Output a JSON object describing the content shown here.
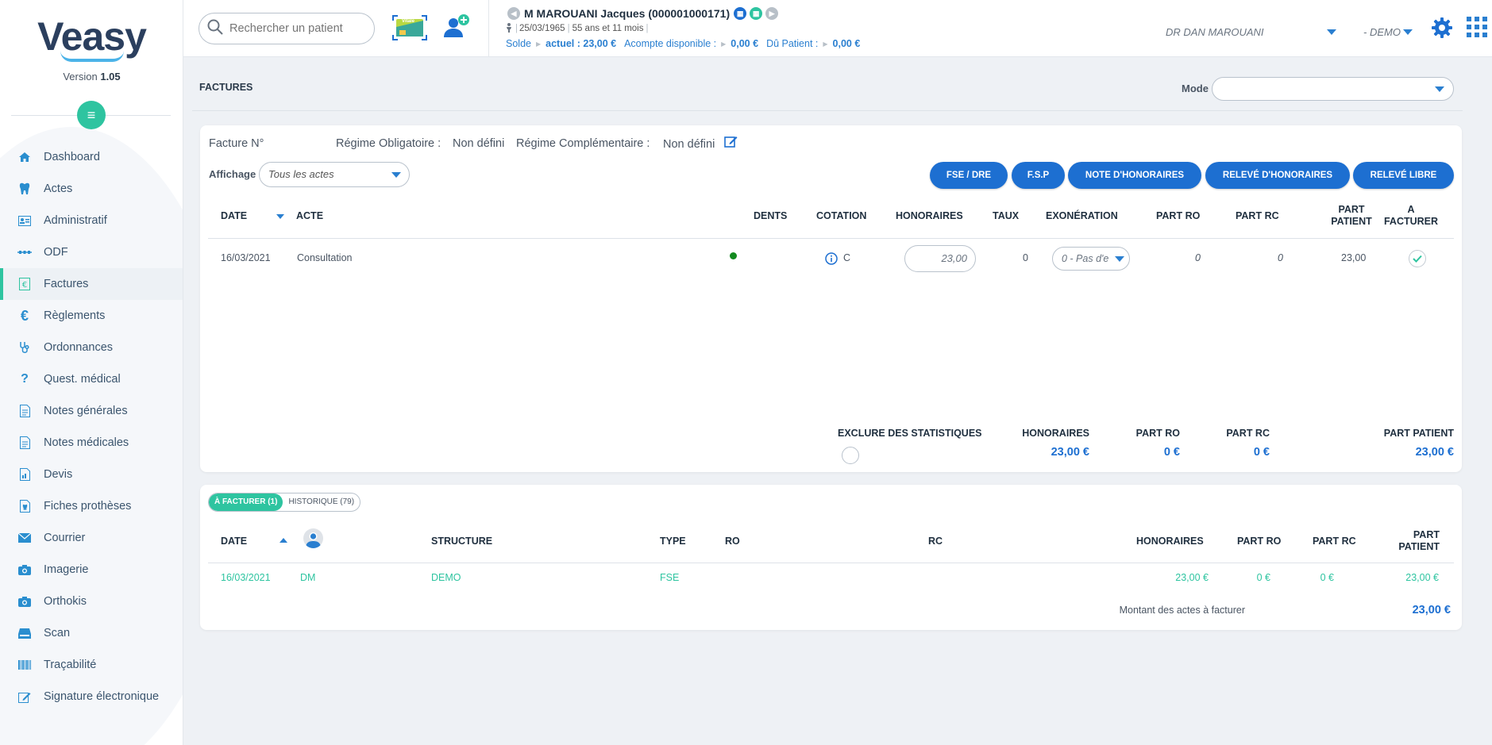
{
  "app": {
    "logo_text": "Veasy",
    "version_label": "Version",
    "version_number": "1.05"
  },
  "sidebar": {
    "items": [
      {
        "label": "Dashboard",
        "icon": "home-icon"
      },
      {
        "label": "Actes",
        "icon": "tooth-icon"
      },
      {
        "label": "Administratif",
        "icon": "id-card-icon"
      },
      {
        "label": "ODF",
        "icon": "braces-icon"
      },
      {
        "label": "Factures",
        "icon": "euro-bill-icon",
        "active": true
      },
      {
        "label": "Règlements",
        "icon": "euro-icon"
      },
      {
        "label": "Ordonnances",
        "icon": "stethoscope-icon"
      },
      {
        "label": "Quest. médical",
        "icon": "question-icon"
      },
      {
        "label": "Notes générales",
        "icon": "document-icon"
      },
      {
        "label": "Notes médicales",
        "icon": "document-icon"
      },
      {
        "label": "Devis",
        "icon": "document-chart-icon"
      },
      {
        "label": "Fiches prothèses",
        "icon": "tooth-document-icon"
      },
      {
        "label": "Courrier",
        "icon": "envelope-icon"
      },
      {
        "label": "Imagerie",
        "icon": "camera-icon"
      },
      {
        "label": "Orthokis",
        "icon": "camera-icon"
      },
      {
        "label": "Scan",
        "icon": "scanner-icon"
      },
      {
        "label": "Traçabilité",
        "icon": "barcode-icon"
      },
      {
        "label": "Signature électronique",
        "icon": "signature-icon"
      }
    ]
  },
  "header": {
    "search_placeholder": "Rechercher un patient",
    "vitale_label": "Vitale",
    "patient_name": "M MAROUANI Jacques (000001000171)",
    "birth_date": "25/03/1965",
    "age": "55 ans et 11 mois",
    "solde_label": "Solde",
    "actuel_label": "actuel : 23,00 €",
    "acompte_label": "Acompte disponible :",
    "acompte_value": "0,00 €",
    "du_patient_label": "Dû Patient :",
    "du_patient_value": "0,00 €",
    "doctor": "DR DAN MAROUANI",
    "structure": "- DEMO"
  },
  "page": {
    "title": "FACTURES",
    "mode_label": "Mode",
    "mode_value": ""
  },
  "invoice": {
    "facture_label": "Facture N°",
    "regime_obl_label": "Régime Obligatoire :",
    "regime_obl_value": "Non défini",
    "regime_comp_label": "Régime Complémentaire :",
    "regime_comp_value": "Non défini",
    "affichage_label": "Affichage",
    "affichage_value": "Tous les actes",
    "buttons": {
      "fse": "FSE / DRE",
      "fsp": "F.S.P",
      "note": "NOTE D'HONORAIRES",
      "releve": "RELEVÉ D'HONORAIRES",
      "libre": "RELEVÉ LIBRE"
    },
    "columns": {
      "date": "DATE",
      "acte": "ACTE",
      "dents": "DENTS",
      "cotation": "COTATION",
      "honoraires": "HONORAIRES",
      "taux": "TAUX",
      "exoneration": "EXONÉRATION",
      "part_ro": "PART RO",
      "part_rc": "PART RC",
      "part_patient_1": "PART",
      "part_patient_2": "PATIENT",
      "a_facturer_1": "A",
      "a_facturer_2": "FACTURER"
    },
    "row": {
      "date": "16/03/2021",
      "acte": "Consultation",
      "cotation": "C",
      "honoraires": "23,00",
      "taux": "0",
      "exoneration": "0 - Pas d'e",
      "part_ro": "0",
      "part_rc": "0",
      "part_patient": "23,00"
    },
    "totals": {
      "exclure_label": "EXCLURE DES STATISTIQUES",
      "honoraires_label": "HONORAIRES",
      "honoraires_value": "23,00 €",
      "part_ro_label": "PART RO",
      "part_ro_value": "0 €",
      "part_rc_label": "PART RC",
      "part_rc_value": "0 €",
      "part_patient_label": "PART PATIENT",
      "part_patient_value": "23,00 €"
    }
  },
  "billing": {
    "tab_a_facturer": "À FACTURER (1)",
    "tab_historique": "HISTORIQUE (79)",
    "columns": {
      "date": "DATE",
      "structure": "STRUCTURE",
      "type": "TYPE",
      "ro": "RO",
      "rc": "RC",
      "honoraires": "HONORAIRES",
      "part_ro": "PART RO",
      "part_rc": "PART RC",
      "part_patient_1": "PART",
      "part_patient_2": "PATIENT"
    },
    "row": {
      "date": "16/03/2021",
      "praticien": "DM",
      "structure": "DEMO",
      "type": "FSE",
      "honoraires": "23,00 €",
      "part_ro": "0 €",
      "part_rc": "0 €",
      "part_patient": "23,00 €"
    },
    "montant_label": "Montant des actes à facturer",
    "montant_value": "23,00 €"
  },
  "colors": {
    "accent_green": "#2ec4a0",
    "primary_blue": "#1d6fd1",
    "link_blue": "#2a7fd0"
  }
}
